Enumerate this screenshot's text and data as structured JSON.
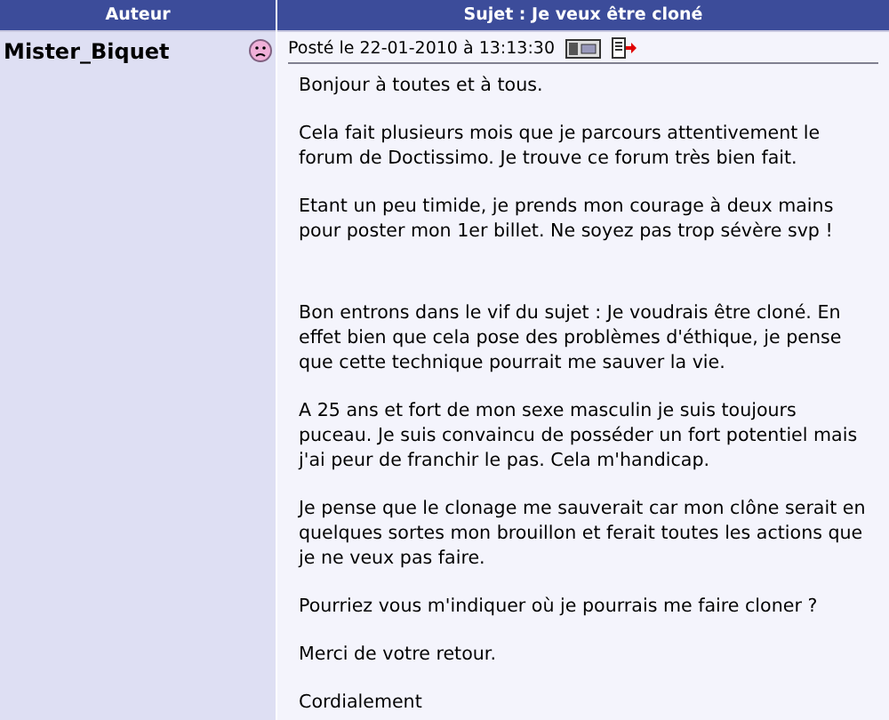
{
  "columns": [
    "Auteur",
    "Sujet : Je veux être cloné"
  ],
  "post": {
    "author": "Mister_Biquet",
    "posted": "Posté le 22-01-2010 à 13:13:30",
    "paragraphs": [
      "Bonjour à toutes et à tous.",
      "Cela fait plusieurs mois que je parcours attentivement le forum de Doctissimo. Je trouve ce forum très bien fait.",
      "Etant un peu timide, je prends mon courage à deux mains pour poster mon 1er billet. Ne soyez pas trop sévère svp !",
      "Bon entrons dans le vif du sujet : Je voudrais être cloné. En effet bien que cela pose des problèmes d'éthique, je pense que cette technique pourrait me sauver la vie.",
      "A 25 ans et fort de mon sexe masculin je suis toujours puceau. Je suis convaincu de posséder un fort potentiel mais j'ai peur de franchir le pas. Cela m'handicap.",
      "Je pense que le clonage me sauverait car mon clône serait en quelques sortes mon brouillon et ferait toutes les actions que je ne veux pas faire.",
      "Pourriez vous m'indiquer où je pourrais me faire cloner ?",
      "Merci de votre retour.",
      "Cordialement"
    ]
  }
}
